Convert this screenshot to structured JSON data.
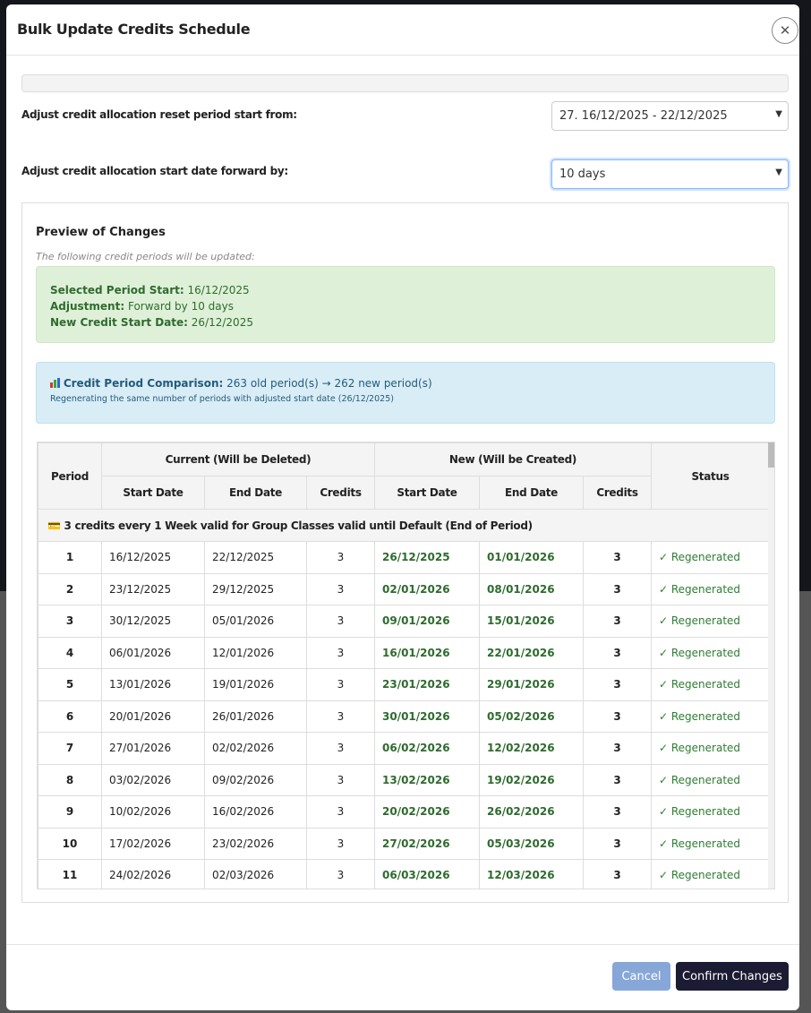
{
  "modal": {
    "title": "Bulk Update Credits Schedule",
    "close_icon": "close-icon"
  },
  "form": {
    "reset_label": "Adjust credit allocation reset period start from:",
    "reset_value": "27. 16/12/2025 - 22/12/2025",
    "forward_label": "Adjust credit allocation start date forward by:",
    "forward_value": "10 days"
  },
  "preview": {
    "title": "Preview of Changes",
    "subtitle": "The following credit periods will be updated:",
    "selected_label": "Selected Period Start:",
    "selected_value": "16/12/2025",
    "adjustment_label": "Adjustment:",
    "adjustment_value": "Forward by 10 days",
    "new_start_label": "New Credit Start Date:",
    "new_start_value": "26/12/2025",
    "comparison_label": "Credit Period Comparison:",
    "comparison_value": "263 old period(s) → 262 new period(s)",
    "comparison_note": "Regenerating the same number of periods with adjusted start date (26/12/2025)"
  },
  "table": {
    "headers": {
      "period": "Period",
      "current": "Current (Will be Deleted)",
      "new": "New (Will be Created)",
      "status": "Status",
      "start": "Start Date",
      "end": "End Date",
      "credits": "Credits"
    },
    "group": "3 credits every 1 Week valid for Group Classes valid until Default (End of Period)",
    "rows": [
      [
        "1",
        "16/12/2025",
        "22/12/2025",
        "3",
        "26/12/2025",
        "01/01/2026",
        "3",
        "✓ Regenerated"
      ],
      [
        "2",
        "23/12/2025",
        "29/12/2025",
        "3",
        "02/01/2026",
        "08/01/2026",
        "3",
        "✓ Regenerated"
      ],
      [
        "3",
        "30/12/2025",
        "05/01/2026",
        "3",
        "09/01/2026",
        "15/01/2026",
        "3",
        "✓ Regenerated"
      ],
      [
        "4",
        "06/01/2026",
        "12/01/2026",
        "3",
        "16/01/2026",
        "22/01/2026",
        "3",
        "✓ Regenerated"
      ],
      [
        "5",
        "13/01/2026",
        "19/01/2026",
        "3",
        "23/01/2026",
        "29/01/2026",
        "3",
        "✓ Regenerated"
      ],
      [
        "6",
        "20/01/2026",
        "26/01/2026",
        "3",
        "30/01/2026",
        "05/02/2026",
        "3",
        "✓ Regenerated"
      ],
      [
        "7",
        "27/01/2026",
        "02/02/2026",
        "3",
        "06/02/2026",
        "12/02/2026",
        "3",
        "✓ Regenerated"
      ],
      [
        "8",
        "03/02/2026",
        "09/02/2026",
        "3",
        "13/02/2026",
        "19/02/2026",
        "3",
        "✓ Regenerated"
      ],
      [
        "9",
        "10/02/2026",
        "16/02/2026",
        "3",
        "20/02/2026",
        "26/02/2026",
        "3",
        "✓ Regenerated"
      ],
      [
        "10",
        "17/02/2026",
        "23/02/2026",
        "3",
        "27/02/2026",
        "05/03/2026",
        "3",
        "✓ Regenerated"
      ],
      [
        "11",
        "24/02/2026",
        "02/03/2026",
        "3",
        "06/03/2026",
        "12/03/2026",
        "3",
        "✓ Regenerated"
      ]
    ]
  },
  "footer": {
    "cancel": "Cancel",
    "confirm": "Confirm Changes"
  }
}
